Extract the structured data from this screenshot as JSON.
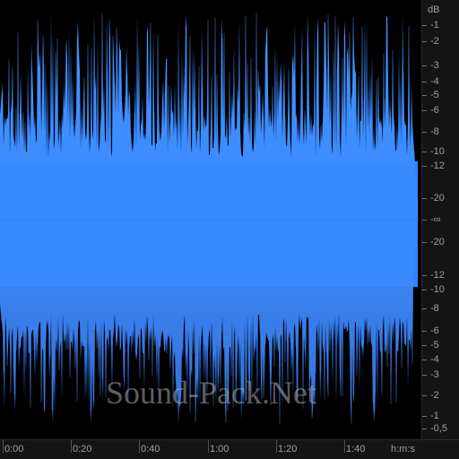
{
  "waveform": {
    "color_top": "#3a8cff",
    "color_bottom": "#2f6fd8",
    "background": "#000000",
    "peak_color": "#6aa8ff"
  },
  "db_ruler": {
    "unit": "dB",
    "labels": [
      "-1",
      "-2",
      "-3",
      "-4",
      "-5",
      "-6",
      "-8",
      "-10",
      "-12",
      "-20",
      "-∞",
      "-20",
      "-12",
      "-10",
      "-8",
      "-6",
      "-5",
      "-4",
      "-3",
      "-2",
      "-1",
      "-0,5"
    ]
  },
  "time_ruler": {
    "labels": [
      "0:00",
      "0:20",
      "0:40",
      "1:00",
      "1:20",
      "1:40"
    ],
    "unit": "h:m:s"
  },
  "watermark": "Sound-Pack.Net"
}
